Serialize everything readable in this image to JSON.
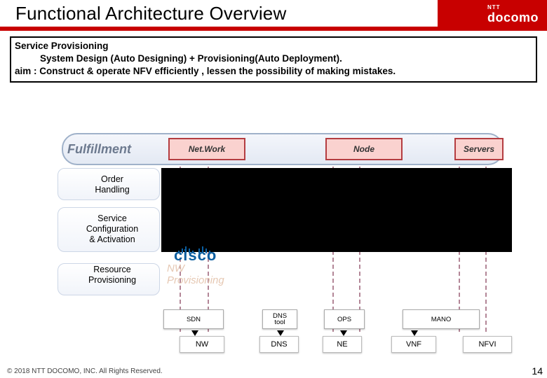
{
  "title": "Functional Architecture Overview",
  "logo": {
    "ntt": "NTT",
    "docomo": "docomo"
  },
  "definition": {
    "line1": "Service Provisioning",
    "line2": "System Design (Auto Designing) + Provisioning(Auto Deployment).",
    "line3": "aim : Construct & operate NFV efficiently , lessen the possibility of making mistakes."
  },
  "fulfillment_label": "Fulfillment",
  "column_headers": {
    "network": "Net.Work",
    "node": "Node",
    "servers": "Servers"
  },
  "rows": {
    "order": "Order\nHandling",
    "sca": "Service\nConfiguration\n& Activation",
    "rp": "Resource\nProvisioning"
  },
  "cisco": "cisco",
  "nw_provisioning": {
    "line1": "NW",
    "line2": "Provisioning"
  },
  "tool_boxes": {
    "sdn": "SDN",
    "dns_tool": "DNS\ntool",
    "ops": "OPS",
    "mano": "MANO"
  },
  "target_boxes": {
    "nw": "NW",
    "dns": "DNS",
    "ne": "NE",
    "vnf": "VNF",
    "nfvi": "NFVI"
  },
  "footer": "© 2018  NTT DOCOMO, INC. All Rights Reserved.",
  "slide_number": "14"
}
